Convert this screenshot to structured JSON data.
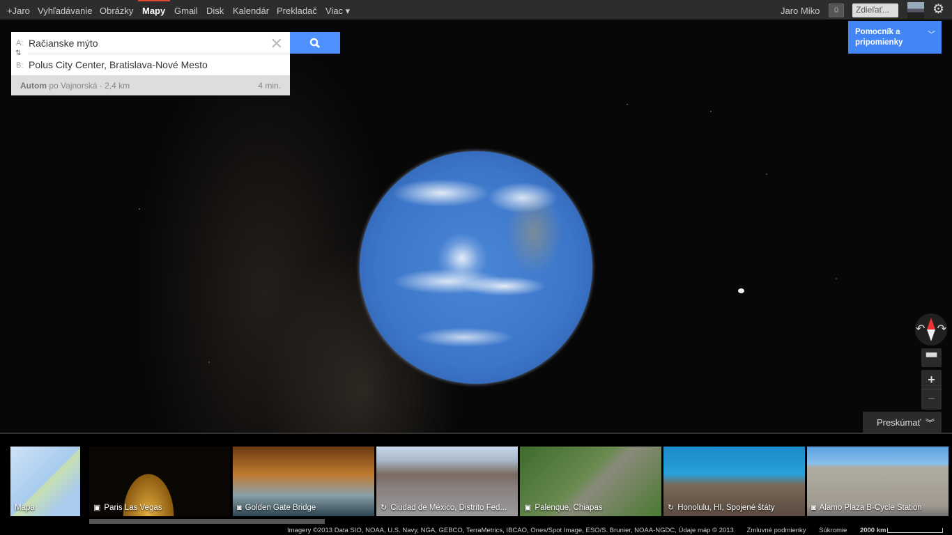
{
  "topbar": {
    "nav": [
      "+Jaro",
      "Vyhľadávanie",
      "Obrázky",
      "Mapy",
      "Gmail",
      "Disk",
      "Kalendár",
      "Prekladač",
      "Viac ▾"
    ],
    "active": "Mapy",
    "user": "Jaro Miko",
    "notifications": "0",
    "share": "Zdieľať..."
  },
  "helper": {
    "label": "Pomocník a pripomienky"
  },
  "directions": {
    "a_label": "A:",
    "a_value": "Račianske mýto",
    "b_label": "B:",
    "b_value": "Polus City Center, Bratislava-Nové Mesto",
    "mode": "Autom",
    "route": "po Vajnorská · 2,4 km",
    "time": "4 min."
  },
  "controls": {
    "explore": "Preskúmať",
    "zoom_in": "+",
    "zoom_out": "−"
  },
  "thumbnails": [
    {
      "label": "Mapa",
      "icon": ""
    },
    {
      "label": "Paris Las Vegas",
      "icon": "video-icon"
    },
    {
      "label": "Golden Gate Bridge",
      "icon": "camera-icon"
    },
    {
      "label": "Ciudad de México, Distrito Fed...",
      "icon": "panorama-icon"
    },
    {
      "label": "Palenque, Chiapas",
      "icon": "video-icon"
    },
    {
      "label": "Honolulu, HI, Spojené štáty",
      "icon": "panorama-icon"
    },
    {
      "label": "Alamo Plaza B-Cycle Station",
      "icon": "camera-icon"
    }
  ],
  "footer": {
    "attribution": "Imagery ©2013 Data SIO, NOAA, U.S. Navy, NGA, GEBCO, TerraMetrics, IBCAO, Ones/Spot Image, ESO/S. Brunier, NOAA-NGDC, Údaje máp © 2013",
    "terms": "Zmluvné podmienky",
    "privacy": "Súkromie",
    "scale": "2000 km"
  }
}
